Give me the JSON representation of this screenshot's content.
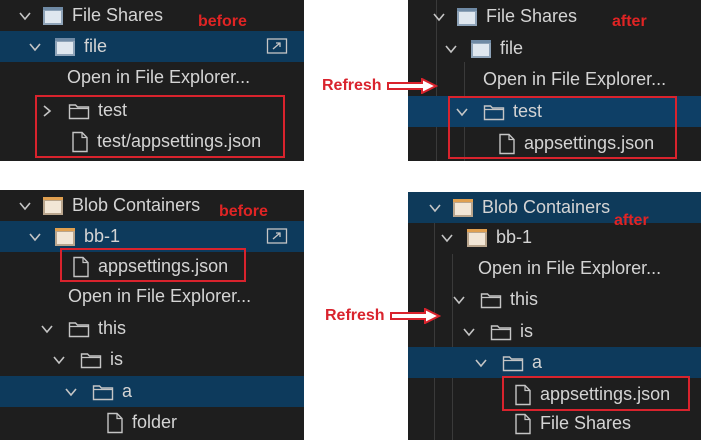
{
  "colors": {
    "panel_bg": "#1e1e1e",
    "selected": "#0d3a5c",
    "annotation": "#d9232d"
  },
  "annotations": {
    "before": "before",
    "after": "after",
    "refresh": "Refresh"
  },
  "q1": {
    "root": "File Shares",
    "share": "file",
    "open": "Open in File Explorer...",
    "test": "test",
    "file": "test/appsettings.json"
  },
  "q2": {
    "root": "File Shares",
    "share": "file",
    "open": "Open in File Explorer...",
    "test": "test",
    "file": "appsettings.json"
  },
  "q3": {
    "root": "Blob Containers",
    "container": "bb-1",
    "file": "appsettings.json",
    "open": "Open in File Explorer...",
    "this": "this",
    "is": "is",
    "a": "a",
    "folder": "folder"
  },
  "q4": {
    "root": "Blob Containers",
    "container": "bb-1",
    "open": "Open in File Explorer...",
    "this": "this",
    "is": "is",
    "a": "a",
    "file": "appsettings.json",
    "file2": "File Shares"
  }
}
